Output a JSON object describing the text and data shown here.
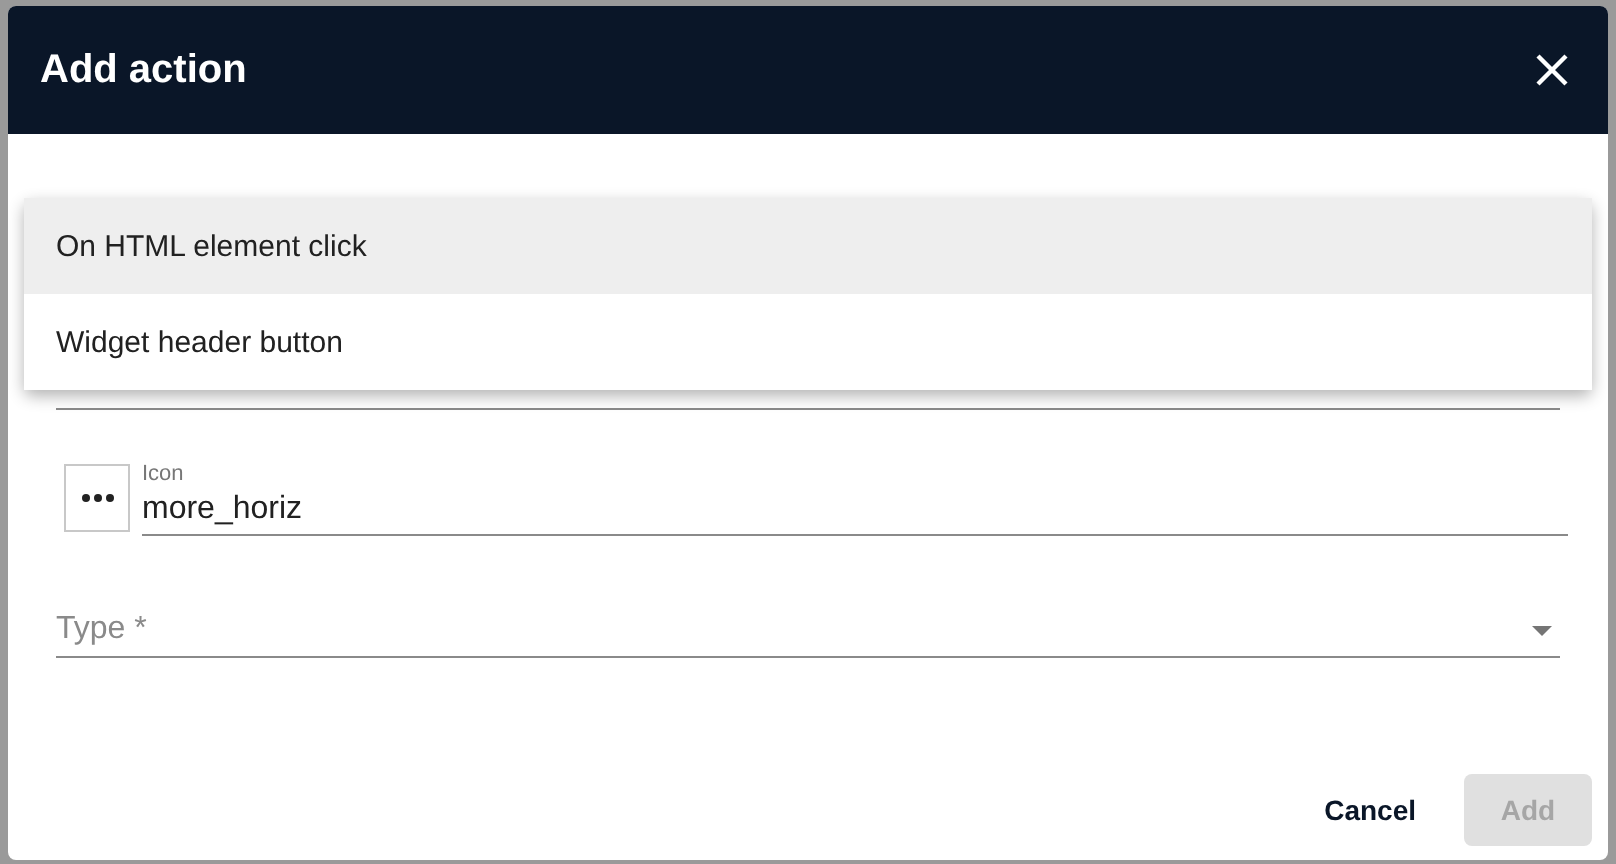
{
  "dialog": {
    "title": "Add action"
  },
  "action_source": {
    "options": [
      {
        "label": "On HTML element click",
        "selected": true
      },
      {
        "label": "Widget header button",
        "selected": false
      }
    ]
  },
  "icon_field": {
    "label": "Icon",
    "value": "more_horiz"
  },
  "type_field": {
    "placeholder": "Type *"
  },
  "buttons": [
    {
      "label": "Cancel",
      "disabled": false
    },
    {
      "label": "Add",
      "disabled": true
    }
  ]
}
